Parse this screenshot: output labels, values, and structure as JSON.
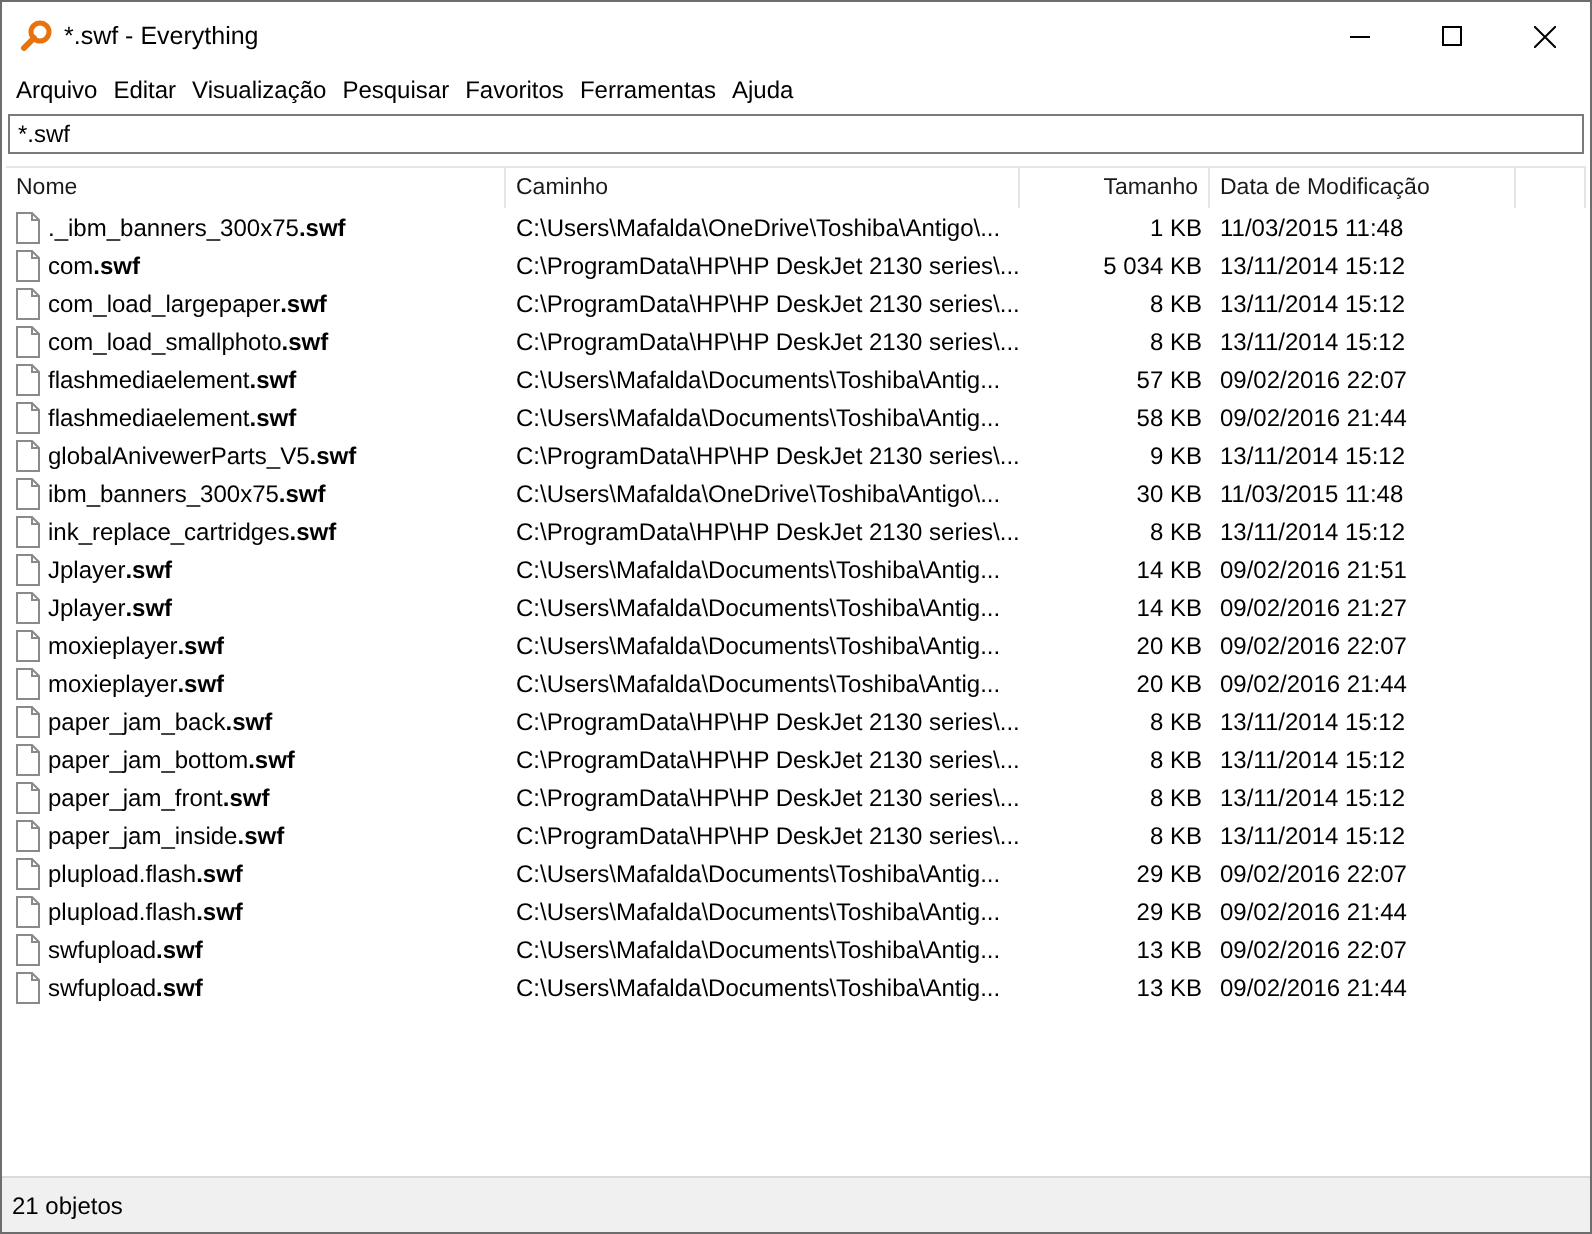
{
  "window": {
    "title": "*.swf - Everything"
  },
  "menu": [
    "Arquivo",
    "Editar",
    "Visualização",
    "Pesquisar",
    "Favoritos",
    "Ferramentas",
    "Ajuda"
  ],
  "search": {
    "value": "*.swf"
  },
  "table": {
    "columns": [
      "Nome",
      "Caminho",
      "Tamanho",
      "Data de Modificação"
    ],
    "rows": [
      [
        "._ibm_banners_300x75**.swf**",
        "C:\\Users\\Mafalda\\OneDrive\\Toshiba\\Antigo\\...",
        "1 KB",
        "11/03/2015 11:48"
      ],
      [
        "com**.swf**",
        "C:\\ProgramData\\HP\\HP DeskJet 2130 series\\...",
        "5 034 KB",
        "13/11/2014 15:12"
      ],
      [
        "com_load_largepaper**.swf**",
        "C:\\ProgramData\\HP\\HP DeskJet 2130 series\\...",
        "8 KB",
        "13/11/2014 15:12"
      ],
      [
        "com_load_smallphoto**.swf**",
        "C:\\ProgramData\\HP\\HP DeskJet 2130 series\\...",
        "8 KB",
        "13/11/2014 15:12"
      ],
      [
        "flashmediaelement**.swf**",
        "C:\\Users\\Mafalda\\Documents\\Toshiba\\Antig...",
        "57 KB",
        "09/02/2016 22:07"
      ],
      [
        "flashmediaelement**.swf**",
        "C:\\Users\\Mafalda\\Documents\\Toshiba\\Antig...",
        "58 KB",
        "09/02/2016 21:44"
      ],
      [
        "globalAnivewerParts_V5**.swf**",
        "C:\\ProgramData\\HP\\HP DeskJet 2130 series\\...",
        "9 KB",
        "13/11/2014 15:12"
      ],
      [
        "ibm_banners_300x75**.swf**",
        "C:\\Users\\Mafalda\\OneDrive\\Toshiba\\Antigo\\...",
        "30 KB",
        "11/03/2015 11:48"
      ],
      [
        "ink_replace_cartridges**.swf**",
        "C:\\ProgramData\\HP\\HP DeskJet 2130 series\\...",
        "8 KB",
        "13/11/2014 15:12"
      ],
      [
        "Jplayer**.swf**",
        "C:\\Users\\Mafalda\\Documents\\Toshiba\\Antig...",
        "14 KB",
        "09/02/2016 21:51"
      ],
      [
        "Jplayer**.swf**",
        "C:\\Users\\Mafalda\\Documents\\Toshiba\\Antig...",
        "14 KB",
        "09/02/2016 21:27"
      ],
      [
        "moxieplayer**.swf**",
        "C:\\Users\\Mafalda\\Documents\\Toshiba\\Antig...",
        "20 KB",
        "09/02/2016 22:07"
      ],
      [
        "moxieplayer**.swf**",
        "C:\\Users\\Mafalda\\Documents\\Toshiba\\Antig...",
        "20 KB",
        "09/02/2016 21:44"
      ],
      [
        "paper_jam_back**.swf**",
        "C:\\ProgramData\\HP\\HP DeskJet 2130 series\\...",
        "8 KB",
        "13/11/2014 15:12"
      ],
      [
        "paper_jam_bottom**.swf**",
        "C:\\ProgramData\\HP\\HP DeskJet 2130 series\\...",
        "8 KB",
        "13/11/2014 15:12"
      ],
      [
        "paper_jam_front**.swf**",
        "C:\\ProgramData\\HP\\HP DeskJet 2130 series\\...",
        "8 KB",
        "13/11/2014 15:12"
      ],
      [
        "paper_jam_inside**.swf**",
        "C:\\ProgramData\\HP\\HP DeskJet 2130 series\\...",
        "8 KB",
        "13/11/2014 15:12"
      ],
      [
        "plupload.flash**.swf**",
        "C:\\Users\\Mafalda\\Documents\\Toshiba\\Antig...",
        "29 KB",
        "09/02/2016 22:07"
      ],
      [
        "plupload.flash**.swf**",
        "C:\\Users\\Mafalda\\Documents\\Toshiba\\Antig...",
        "29 KB",
        "09/02/2016 21:44"
      ],
      [
        "swfupload**.swf**",
        "C:\\Users\\Mafalda\\Documents\\Toshiba\\Antig...",
        "13 KB",
        "09/02/2016 22:07"
      ],
      [
        "swfupload**.swf**",
        "C:\\Users\\Mafalda\\Documents\\Toshiba\\Antig...",
        "13 KB",
        "09/02/2016 21:44"
      ]
    ]
  },
  "status_bar": "21 objetos"
}
